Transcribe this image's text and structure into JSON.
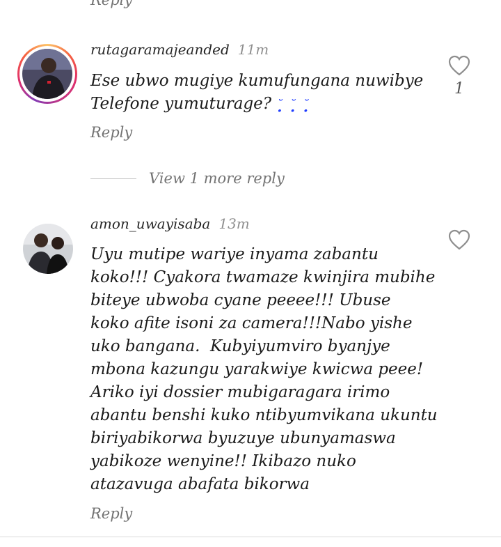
{
  "top_reply_label": "Reply",
  "comments": [
    {
      "username": "rutagaramajeanded",
      "time": "11m",
      "text": "Ese ubwo mugiye kumufungana nuwibye\nTelefone yumuturage?",
      "emoji": "˘̩̩̩̥̩̥ ˘̩̩̩̥̩̥ ˘̩̩̩̥̩̥",
      "reply_label": "Reply",
      "like_count": "1",
      "avatar_icon": "person-avatar"
    },
    {
      "username": "amon_uwayisaba",
      "time": "13m",
      "text": "Uyu mutipe wariye inyama zabantu\nkoko!!! Cyakora twamaze kwinjira mubihe\nbiteye ubwoba cyane peeee!!! Ubuse\nkoko afite isoni za camera!!!Nabo yishe\nuko bangana.  Kubyiyumviro byanjye\nmbona kazungu yarakwiye kwicwa peee!\nAriko iyi dossier mubigaragara irimo\nabantu benshi kuko ntibyumvikana ukuntu\nbiriyabikorwa byuzuye ubunyamaswa\nyabikoze wenyine!! Ikibazo nuko\natazavuga abafata bikorwa",
      "reply_label": "Reply",
      "avatar_icon": "couple-avatar"
    }
  ],
  "view_more_replies": "View 1 more reply",
  "colors": {
    "accent_blue": "#1e3cff",
    "muted": "#737373"
  }
}
